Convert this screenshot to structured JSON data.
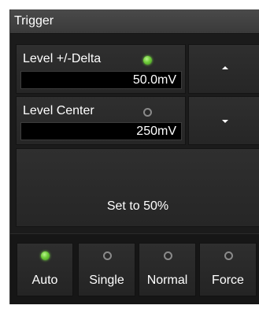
{
  "panel": {
    "title": "Trigger"
  },
  "level_delta": {
    "label": "Level +/-Delta",
    "value": "50.0mV",
    "indicator": "on"
  },
  "level_center": {
    "label": "Level Center",
    "value": "250mV",
    "indicator": "off"
  },
  "increment": {
    "icon": "up-arrow-icon"
  },
  "decrement": {
    "icon": "down-arrow-icon"
  },
  "set50": {
    "label": "Set to 50%"
  },
  "modes": [
    {
      "label": "Auto",
      "indicator": "on"
    },
    {
      "label": "Single",
      "indicator": "off"
    },
    {
      "label": "Normal",
      "indicator": "off"
    },
    {
      "label": "Force",
      "indicator": "off"
    }
  ],
  "colors": {
    "panel_background": "#1b1b1b",
    "button_face": "#2f2f2f",
    "title_bar": "#444444",
    "indicator_on": "#6fcb3a",
    "indicator_off": "#8a8a8a",
    "text": "#ffffff"
  }
}
